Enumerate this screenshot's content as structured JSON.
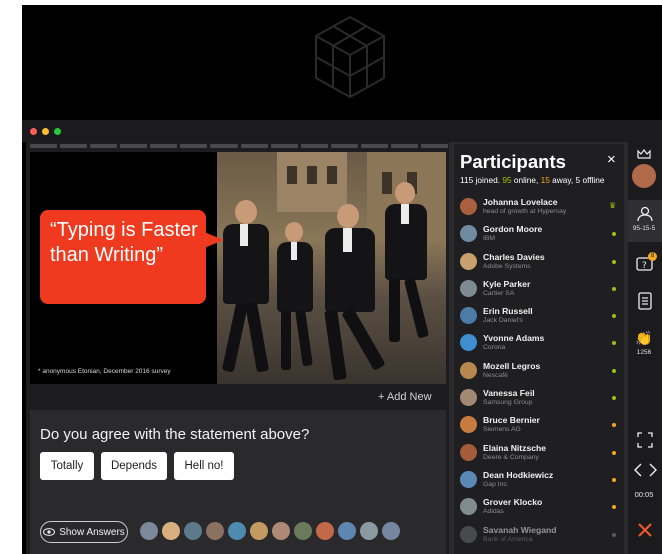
{
  "slide": {
    "quote": "“Typing is Faster than Writing”",
    "footnote": "* anonymous Etonian, December 2016 survey",
    "progress_segments": 14
  },
  "add_new": "+ Add New",
  "poll": {
    "question": "Do you agree with the statement above?",
    "options": [
      "Totally",
      "Depends",
      "Hell no!"
    ],
    "show_answers": "Show Answers",
    "avatar_colors": [
      "#7a8a9a",
      "#d8b080",
      "#5c7a8c",
      "#8b7160",
      "#4f8ab0",
      "#c29a62",
      "#b08878",
      "#6b7a5a",
      "#c26a48",
      "#5f86b0",
      "#8a9aa0",
      "#7486a0"
    ]
  },
  "participants": {
    "title": "Participants",
    "close": "×",
    "stats": {
      "joined": "115",
      "joined_label": "joined.",
      "online": "95",
      "online_label": "online,",
      "away": "15",
      "away_label": "away,",
      "offline": "5 offline"
    },
    "colors": {
      "online": "#9bbf1a",
      "away": "#f5a623",
      "offline": "#8d8d8f"
    },
    "list": [
      {
        "name": "Johanna Lovelace",
        "company": "head of growth at Hypersay",
        "status": "host",
        "avatar": "#a9603f"
      },
      {
        "name": "Gordon Moore",
        "company": "IBM",
        "status": "online",
        "avatar": "#6f8aa1"
      },
      {
        "name": "Charles Davies",
        "company": "Adobe Systems",
        "status": "online",
        "avatar": "#c8a070"
      },
      {
        "name": "Kyle Parker",
        "company": "Cartier SA",
        "status": "online",
        "avatar": "#7c8b94"
      },
      {
        "name": "Erin Russell",
        "company": "Jack Daniel's",
        "status": "online",
        "avatar": "#4d7aa6"
      },
      {
        "name": "Yvonne Adams",
        "company": "Corona",
        "status": "online",
        "avatar": "#3f8fd0"
      },
      {
        "name": "Mozell Legros",
        "company": "Nescafé",
        "status": "online",
        "avatar": "#b7874f"
      },
      {
        "name": "Vanessa Feil",
        "company": "Samsung Group",
        "status": "online",
        "avatar": "#a48876"
      },
      {
        "name": "Bruce Bernier",
        "company": "Siemens AG",
        "status": "away",
        "avatar": "#c77b3e"
      },
      {
        "name": "Elaina Nitzsche",
        "company": "Deere & Company",
        "status": "away",
        "avatar": "#a45c3a"
      },
      {
        "name": "Dean Hodkiewicz",
        "company": "Gap Inc.",
        "status": "away",
        "avatar": "#5c88b8"
      },
      {
        "name": "Grover Klocko",
        "company": "Adidas",
        "status": "away",
        "avatar": "#808c90"
      },
      {
        "name": "Savanah Wiegand",
        "company": "Bank of America",
        "status": "offline",
        "avatar": "#6a7070"
      }
    ]
  },
  "rail": {
    "participants_count": "95-15-5",
    "reactions_count": "1256",
    "questions_badge": "8",
    "timer": "00:05"
  }
}
